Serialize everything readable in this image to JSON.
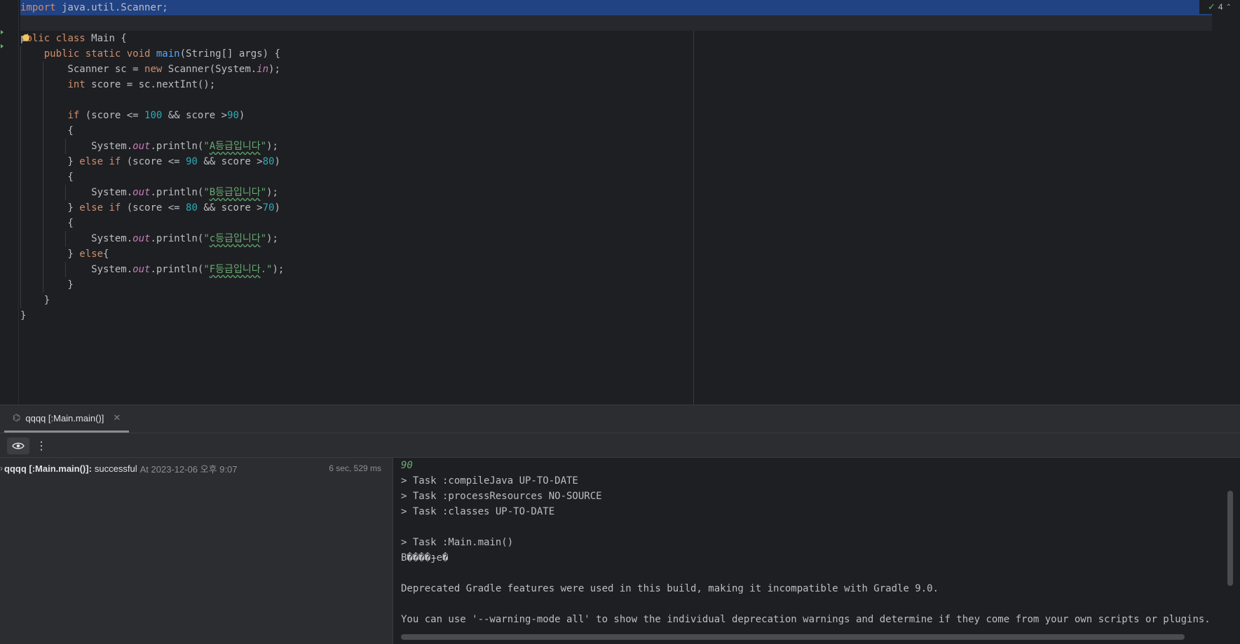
{
  "editor": {
    "inspection_count": "4",
    "lines": [
      [
        {
          "t": "import",
          "c": "kw"
        },
        {
          "t": " java.util.Scanner;"
        }
      ],
      [],
      [
        {
          "t": "p"
        },
        {
          "bulb": true
        },
        {
          "t": "blic class",
          "c": "kw"
        },
        {
          "t": " Main {"
        }
      ],
      [
        {
          "t": "    "
        },
        {
          "t": "public static void",
          "c": "kw"
        },
        {
          "t": " "
        },
        {
          "t": "main",
          "c": "fn"
        },
        {
          "t": "(String[] args) {"
        }
      ],
      [
        {
          "t": "        Scanner sc = "
        },
        {
          "t": "new",
          "c": "kw"
        },
        {
          "t": " Scanner(System."
        },
        {
          "t": "in",
          "c": "st"
        },
        {
          "t": ");"
        }
      ],
      [
        {
          "t": "        "
        },
        {
          "t": "int",
          "c": "kw"
        },
        {
          "t": " score = sc.nextInt();"
        }
      ],
      [],
      [
        {
          "t": "        "
        },
        {
          "t": "if",
          "c": "kw"
        },
        {
          "t": " (score <= "
        },
        {
          "t": "100",
          "c": "num"
        },
        {
          "t": " && score >"
        },
        {
          "t": "90",
          "c": "num"
        },
        {
          "t": ")"
        }
      ],
      [
        {
          "t": "        {"
        }
      ],
      [
        {
          "t": "            System."
        },
        {
          "t": "out",
          "c": "st"
        },
        {
          "t": ".println("
        },
        {
          "t": "\"",
          "c": "str"
        },
        {
          "t": "A등급입니다",
          "c": "str kr"
        },
        {
          "t": "\"",
          "c": "str"
        },
        {
          "t": ");"
        }
      ],
      [
        {
          "t": "        } "
        },
        {
          "t": "else if",
          "c": "kw"
        },
        {
          "t": " (score <= "
        },
        {
          "t": "90",
          "c": "num"
        },
        {
          "t": " && score >"
        },
        {
          "t": "80",
          "c": "num"
        },
        {
          "t": ")"
        }
      ],
      [
        {
          "t": "        {"
        }
      ],
      [
        {
          "t": "            System."
        },
        {
          "t": "out",
          "c": "st"
        },
        {
          "t": ".println("
        },
        {
          "t": "\"",
          "c": "str"
        },
        {
          "t": "B등급입니다",
          "c": "str kr"
        },
        {
          "t": "\"",
          "c": "str"
        },
        {
          "t": ");"
        }
      ],
      [
        {
          "t": "        } "
        },
        {
          "t": "else if",
          "c": "kw"
        },
        {
          "t": " (score <= "
        },
        {
          "t": "80",
          "c": "num"
        },
        {
          "t": " && score >"
        },
        {
          "t": "70",
          "c": "num"
        },
        {
          "t": ")"
        }
      ],
      [
        {
          "t": "        {"
        }
      ],
      [
        {
          "t": "            System."
        },
        {
          "t": "out",
          "c": "st"
        },
        {
          "t": ".println("
        },
        {
          "t": "\"",
          "c": "str"
        },
        {
          "t": "c등급입니다",
          "c": "str kr"
        },
        {
          "t": "\"",
          "c": "str"
        },
        {
          "t": ");"
        }
      ],
      [
        {
          "t": "        } "
        },
        {
          "t": "else",
          "c": "kw"
        },
        {
          "t": "{"
        }
      ],
      [
        {
          "t": "            System."
        },
        {
          "t": "out",
          "c": "st"
        },
        {
          "t": ".println("
        },
        {
          "t": "\"",
          "c": "str"
        },
        {
          "t": "F등급입니다",
          "c": "str kr"
        },
        {
          "t": ".\"",
          "c": "str"
        },
        {
          "t": ");"
        }
      ],
      [
        {
          "t": "        }"
        }
      ],
      [
        {
          "t": "    }"
        }
      ],
      [
        {
          "t": "}"
        }
      ]
    ]
  },
  "run_window": {
    "tab_label": "qqqq [:Main.main()]",
    "build": {
      "name": "qqqq [:Main.main()]:",
      "status": "successful",
      "time": "At 2023-12-06 오후 9:07",
      "duration": "6 sec, 529 ms"
    },
    "console": [
      {
        "text": "90",
        "kind": "input"
      },
      {
        "text": "> Task :compileJava UP-TO-DATE"
      },
      {
        "text": "> Task :processResources NO-SOURCE"
      },
      {
        "text": "> Task :classes UP-TO-DATE"
      },
      {
        "text": ""
      },
      {
        "text": "> Task :Main.main()"
      },
      {
        "text": "B����ɟe�"
      },
      {
        "text": ""
      },
      {
        "text": "Deprecated Gradle features were used in this build, making it incompatible with Gradle 9.0."
      },
      {
        "text": ""
      },
      {
        "text": "You can use '--warning-mode all' to show the individual deprecation warnings and determine if they come from your own scripts or plugins."
      }
    ]
  },
  "icons": {
    "inspection": "check-icon",
    "tab": "tool-window-icon",
    "close": "close-icon",
    "eye": "eye-icon",
    "more": "more-vertical-icon",
    "bulb": "intention-bulb-icon"
  },
  "colors": {
    "editor_bg": "#1e1f22",
    "panel_bg": "#2b2d30",
    "selection": "#214283",
    "keyword": "#cf8e6d",
    "function": "#56a8f5",
    "number": "#2aacb8",
    "string": "#6aab73",
    "static_field": "#c77dbb"
  }
}
